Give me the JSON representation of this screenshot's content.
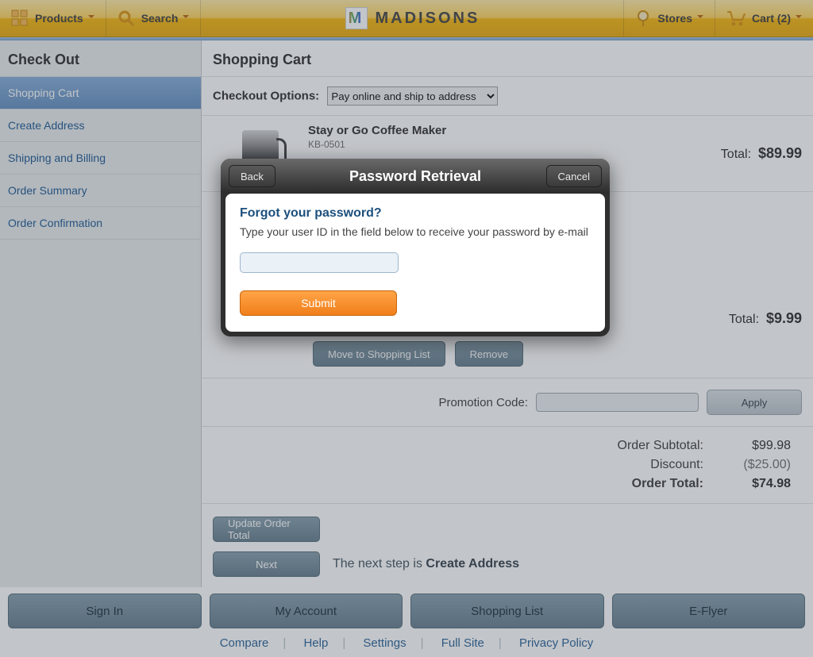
{
  "toolbar": {
    "products": "Products",
    "search": "Search",
    "brand": "MADISONS",
    "stores": "Stores",
    "cart": "Cart (2)"
  },
  "sidebar": {
    "title": "Check Out",
    "items": [
      "Shopping Cart",
      "Create Address",
      "Shipping and Billing",
      "Order Summary",
      "Order Confirmation"
    ]
  },
  "main": {
    "title": "Shopping Cart",
    "checkout_options_label": "Checkout Options:",
    "checkout_option_selected": "Pay online and ship to address",
    "items": [
      {
        "name": "Stay or Go Coffee Maker",
        "sku": "KB-0501",
        "total_label": "Total:",
        "total": "$89.99"
      }
    ],
    "item2_total_label": "Total:",
    "item2_total": "$9.99",
    "move_to_list": "Move to Shopping List",
    "remove": "Remove",
    "promo_label": "Promotion Code:",
    "apply": "Apply",
    "subtotal_label": "Order Subtotal:",
    "subtotal": "$99.98",
    "discount_label": "Discount:",
    "discount": "($25.00)",
    "total_label": "Order Total:",
    "total": "$74.98",
    "update": "Update Order Total",
    "next": "Next",
    "next_msg_prefix": "The next step is ",
    "next_msg_step": "Create Address"
  },
  "bottom": {
    "buttons": [
      "Sign In",
      "My Account",
      "Shopping List",
      "E-Flyer"
    ],
    "links": [
      "Compare",
      "Help",
      "Settings",
      "Full Site",
      "Privacy Policy"
    ]
  },
  "modal": {
    "back": "Back",
    "cancel": "Cancel",
    "title": "Password Retrieval",
    "heading": "Forgot your password?",
    "desc": "Type your user ID in the field below to receive your password by e-mail",
    "submit": "Submit"
  }
}
